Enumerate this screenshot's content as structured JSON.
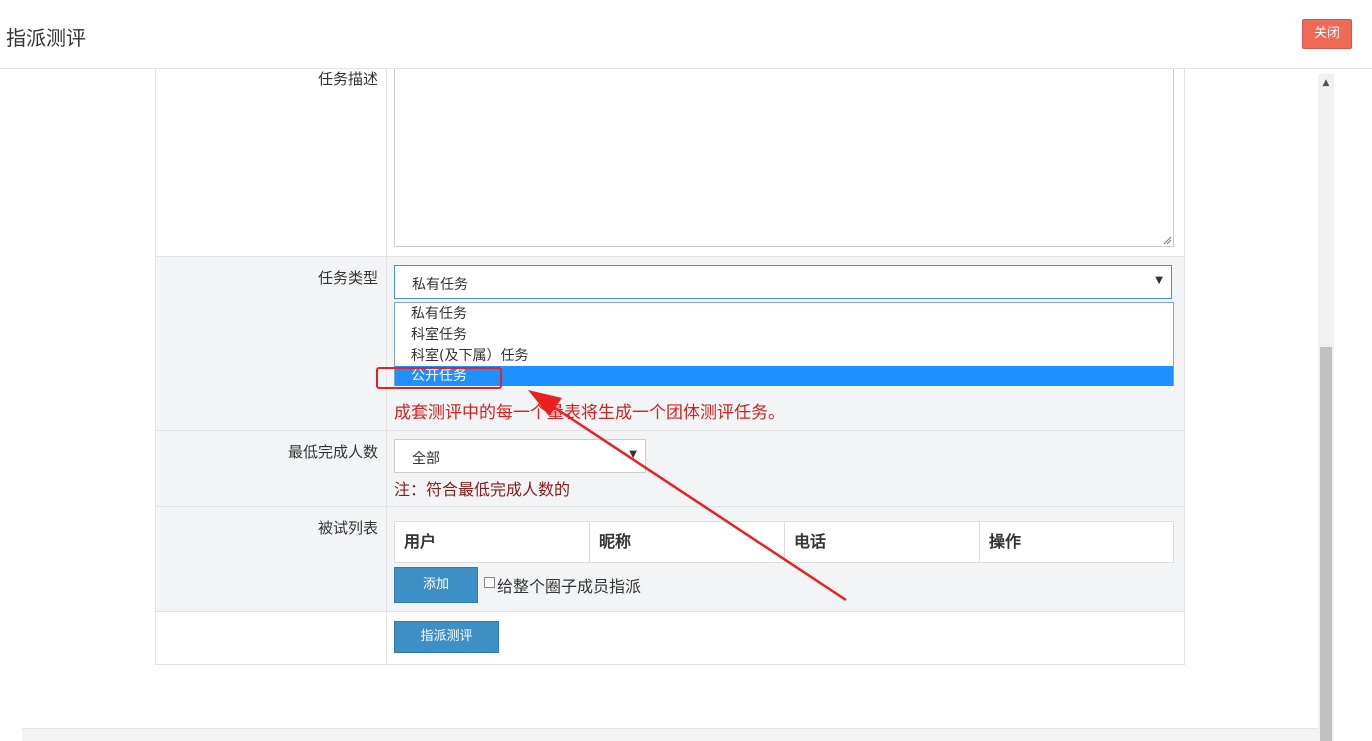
{
  "header": {
    "title": "指派测评",
    "close_label": "关闭"
  },
  "form": {
    "description": {
      "label": "任务描述",
      "value": ""
    },
    "task_type": {
      "label": "任务类型",
      "selected": "私有任务",
      "options": [
        "私有任务",
        "科室任务",
        "科室(及下属）任务",
        "公开任务"
      ],
      "highlighted": "公开任务",
      "hint": "成套测评中的每一个量表将生成一个团体测评任务。"
    },
    "min_completion": {
      "label": "最低完成人数",
      "selected": "全部",
      "note": "注：符合最低完成人数的"
    },
    "subject_list": {
      "label": "被试列表",
      "columns": [
        "用户",
        "昵称",
        "电话",
        "操作"
      ],
      "add_label": "添加",
      "checkbox_label": "给整个圈子成员指派"
    },
    "submit_label": "指派测评"
  },
  "colors": {
    "accent": "#3d8fc6",
    "danger": "#ef6a55",
    "highlight": "#1e90ff",
    "annotation": "#e8201f"
  }
}
